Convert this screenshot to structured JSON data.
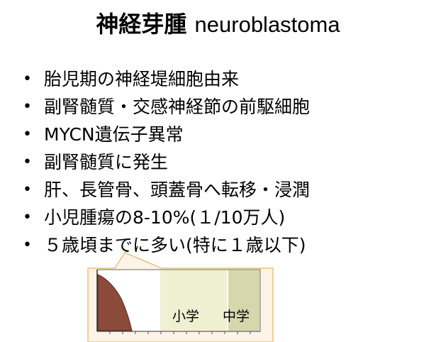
{
  "slide": {
    "title_ja": "神経芽腫",
    "title_en": "neuroblastoma",
    "bullets": [
      "胎児期の神経堤細胞由来",
      "副腎髄質・交感神経節の前駆細胞",
      "MYCN遺伝子異常",
      "副腎髄質に発生",
      "肝、長管骨、頭蓋骨へ転移・浸潤",
      "小児腫瘍の8-10%(１/10万人)",
      "５歳頃までに多い(特に１歳以下)"
    ],
    "bullet_marker": "•"
  },
  "chart_data": {
    "type": "area",
    "labels": [
      "小学",
      "中学"
    ],
    "colors": {
      "curve_fill": "#8b4a3a",
      "elementary_band": "#efefd2",
      "middle_band": "#d7d7ae",
      "callout_border": "#e9c08a",
      "callout_fill": "#fdf3e6"
    }
  }
}
